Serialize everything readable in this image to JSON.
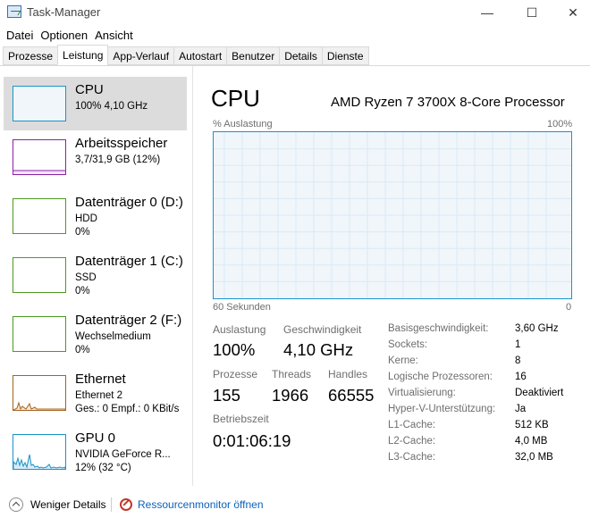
{
  "window": {
    "title": "Task-Manager"
  },
  "menu": [
    "Datei",
    "Optionen",
    "Ansicht"
  ],
  "tabs": [
    "Prozesse",
    "Leistung",
    "App-Verlauf",
    "Autostart",
    "Benutzer",
    "Details",
    "Dienste"
  ],
  "sidebar": [
    {
      "title": "CPU",
      "line1": "100% 4,10 GHz",
      "line2": "",
      "color": "#1a93c9",
      "active": true
    },
    {
      "title": "Arbeitsspeicher",
      "line1": "3,7/31,9 GB (12%)",
      "line2": "",
      "color": "#8b1fa9",
      "active": false
    },
    {
      "title": "Datenträger 0 (D:)",
      "line1": "HDD",
      "line2": "0%",
      "color": "#4a9b1f",
      "active": false
    },
    {
      "title": "Datenträger 1 (C:)",
      "line1": "SSD",
      "line2": "0%",
      "color": "#4a9b1f",
      "active": false
    },
    {
      "title": "Datenträger 2 (F:)",
      "line1": "Wechselmedium",
      "line2": "0%",
      "color": "#4a9b1f",
      "active": false
    },
    {
      "title": "Ethernet",
      "line1": "Ethernet 2",
      "line2": "Ges.: 0 Empf.: 0 KBit/s",
      "color": "#a5641f",
      "active": false
    },
    {
      "title": "GPU 0",
      "line1": "NVIDIA GeForce R...",
      "line2": "12% (32 °C)",
      "color": "#1a93c9",
      "active": false
    }
  ],
  "cpu": {
    "title": "CPU",
    "processor": "AMD Ryzen 7 3700X 8-Core Processor",
    "graph_label_top_left": "% Auslastung",
    "graph_label_top_right": "100%",
    "graph_label_bottom_left": "60 Sekunden",
    "graph_label_bottom_right": "0",
    "graph_usage_fraction": 1.0
  },
  "stats": {
    "auslastung_label": "Auslastung",
    "auslastung": "100%",
    "geschwindigkeit_label": "Geschwindigkeit",
    "geschwindigkeit": "4,10 GHz",
    "prozesse_label": "Prozesse",
    "prozesse": "155",
    "threads_label": "Threads",
    "threads": "1966",
    "handles_label": "Handles",
    "handles": "66555",
    "betriebszeit_label": "Betriebszeit",
    "betriebszeit": "0:01:06:19"
  },
  "info": [
    {
      "label": "Basisgeschwindigkeit:",
      "value": "3,60 GHz"
    },
    {
      "label": "Sockets:",
      "value": "1"
    },
    {
      "label": "Kerne:",
      "value": "8"
    },
    {
      "label": "Logische Prozessoren:",
      "value": "16"
    },
    {
      "label": "Virtualisierung:",
      "value": "Deaktiviert"
    },
    {
      "label": "Hyper-V-Unterstützung:",
      "value": "Ja"
    },
    {
      "label": "L1-Cache:",
      "value": "512 KB"
    },
    {
      "label": "L2-Cache:",
      "value": "4,0 MB"
    },
    {
      "label": "L3-Cache:",
      "value": "32,0 MB"
    }
  ],
  "footer": {
    "less_details": "Weniger Details",
    "resource_monitor": "Ressourcenmonitor öffnen"
  }
}
